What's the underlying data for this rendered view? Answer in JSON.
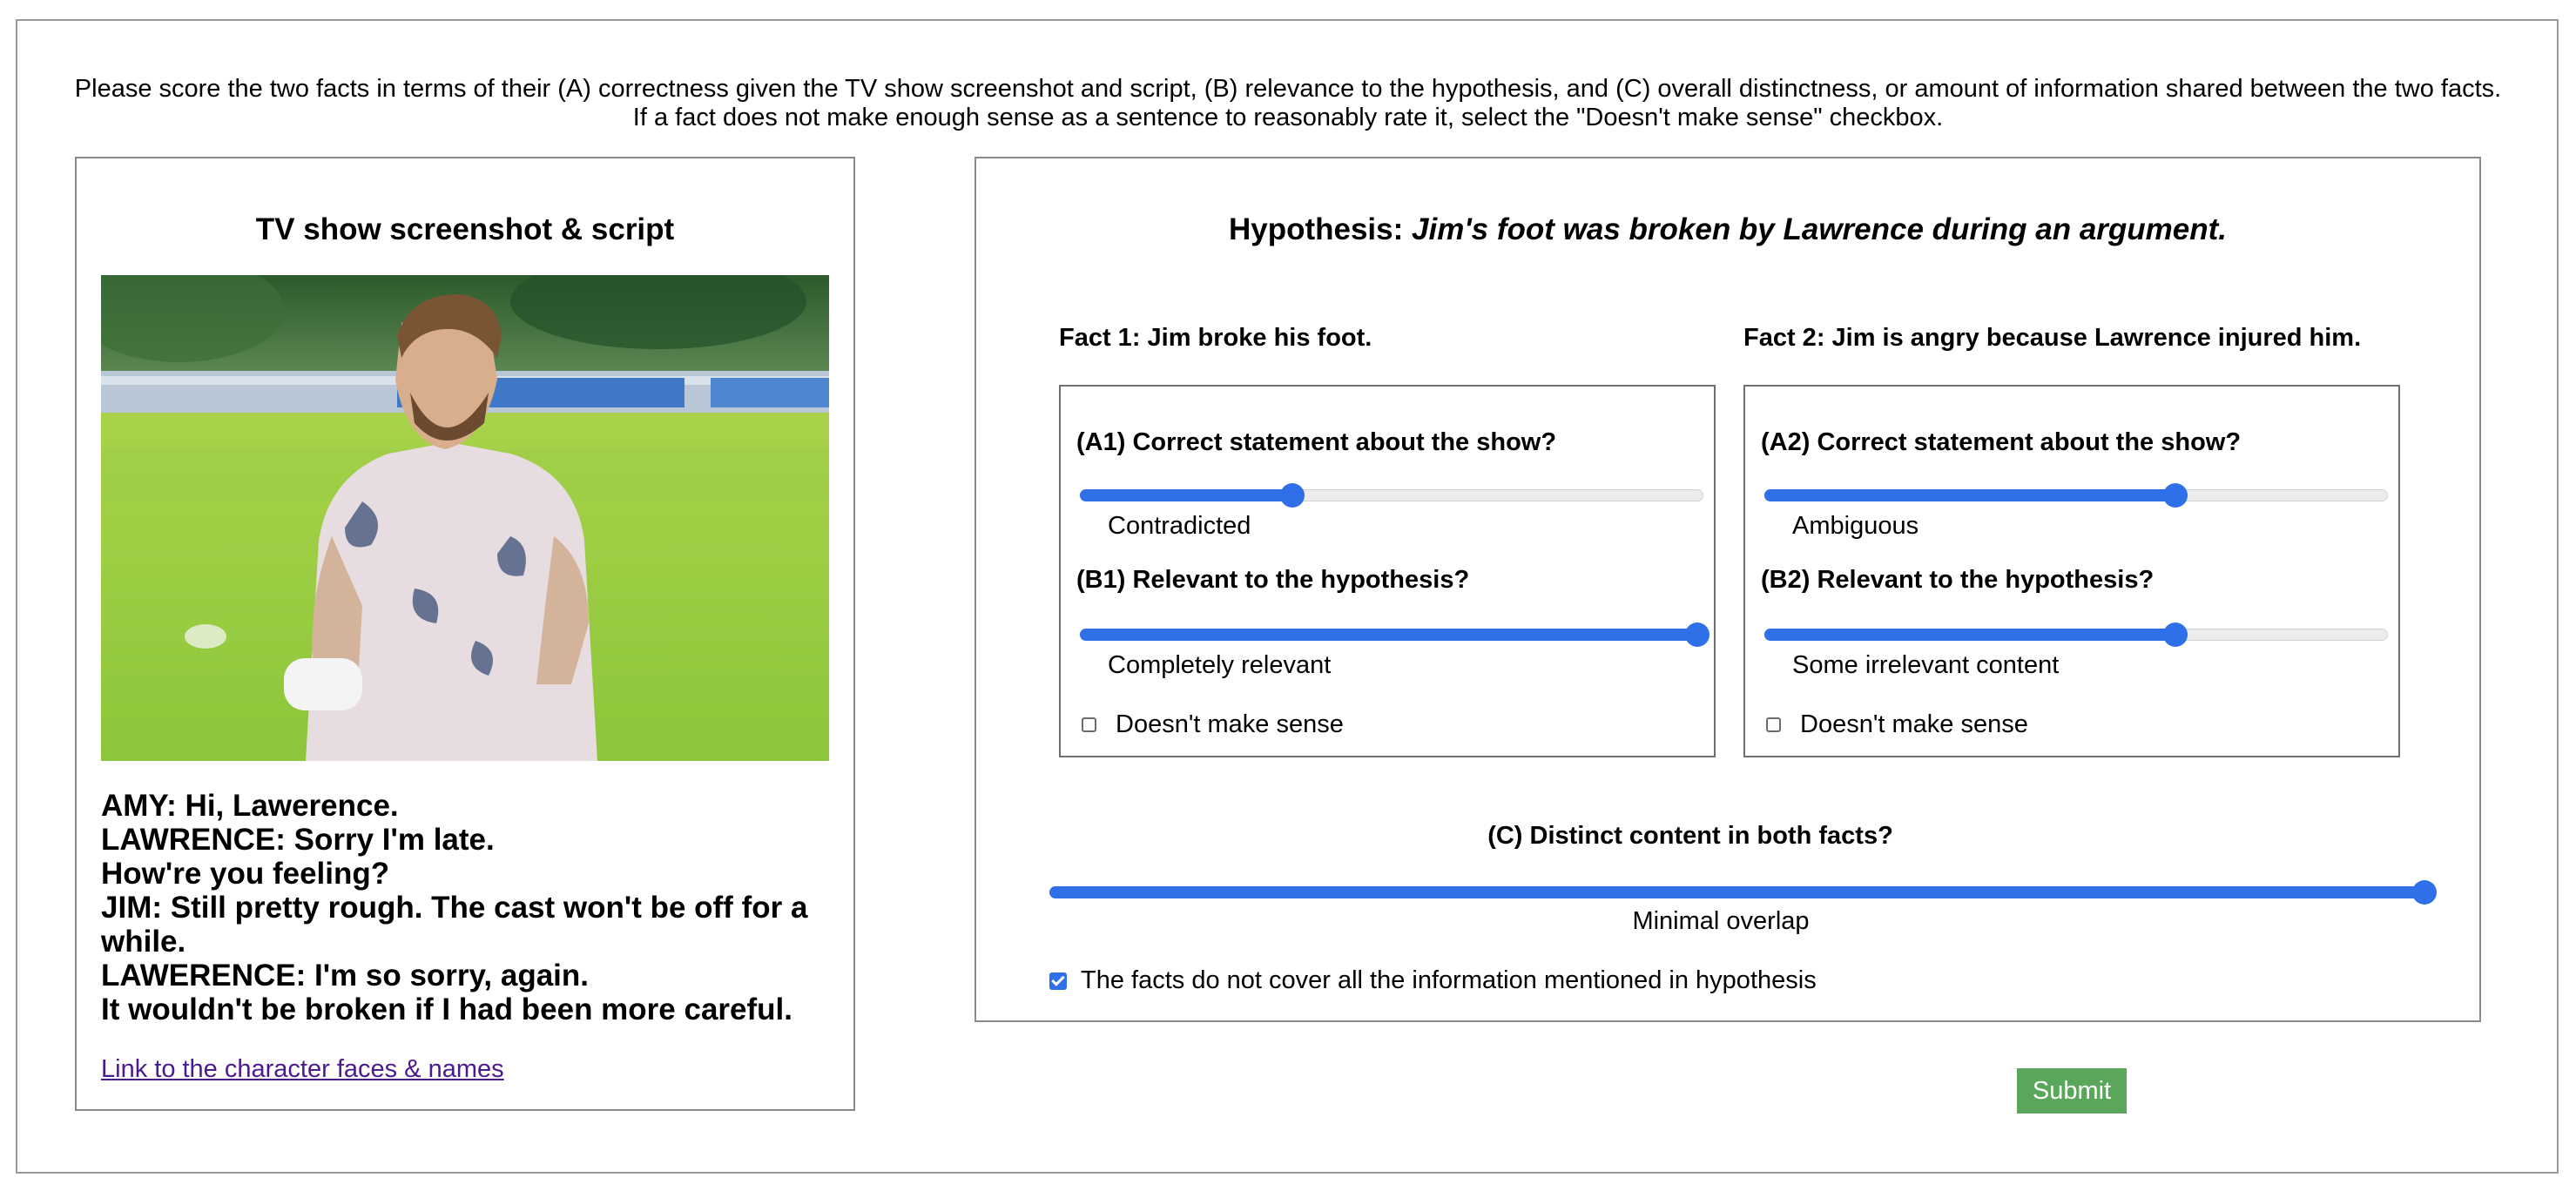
{
  "instructions": {
    "line1": "Please score the two facts in terms of their (A) correctness given the TV show screenshot and script, (B) relevance to the hypothesis, and (C) overall distinctness, or amount of information shared between the two facts.",
    "line2": "If a fact does not make enough sense as a sentence to reasonably rate it, select the \"Doesn't make sense\" checkbox."
  },
  "left_panel": {
    "title": "TV show screenshot & script",
    "script_lines": [
      "AMY: Hi, Lawerence.",
      "LAWRENCE: Sorry I'm late.",
      "How're you feeling?",
      "JIM: Still pretty rough. The cast won't be off for a while.",
      "LAWERENCE: I'm so sorry, again.",
      "It wouldn't be broken if I had been more careful."
    ],
    "link_text": "Link to the character faces & names"
  },
  "hypothesis": {
    "label": "Hypothesis:",
    "text": "Jim's foot was broken by Lawrence during an argument."
  },
  "fact1": {
    "title": "Fact 1: Jim broke his foot.",
    "q_correct": "(A1) Correct statement about the show?",
    "correct_value": "Contradicted",
    "correct_level": 0.34,
    "q_relevant": "(B1) Relevant to the hypothesis?",
    "relevant_value": "Completely relevant",
    "relevant_level": 1.0,
    "nonsense_label": "Doesn't make sense",
    "nonsense_checked": false
  },
  "fact2": {
    "title": "Fact 2: Jim is angry because Lawrence injured him.",
    "q_correct": "(A2) Correct statement about the show?",
    "correct_value": "Ambiguous",
    "correct_level": 0.66,
    "q_relevant": "(B2) Relevant to the hypothesis?",
    "relevant_value": "Some irrelevant content",
    "relevant_level": 0.66,
    "nonsense_label": "Doesn't make sense",
    "nonsense_checked": false
  },
  "distinct": {
    "label": "(C) Distinct content in both facts?",
    "value": "Minimal overlap",
    "level": 1.0
  },
  "coverage": {
    "label": "The facts do not cover all the information mentioned in hypothesis",
    "checked": true
  },
  "submit_label": "Submit",
  "colors": {
    "slider_accent": "#2f6fe8",
    "submit_bg": "#5aa75c",
    "link": "#4b1a8c"
  },
  "icons": {
    "checkbox_checked": "check-icon"
  }
}
